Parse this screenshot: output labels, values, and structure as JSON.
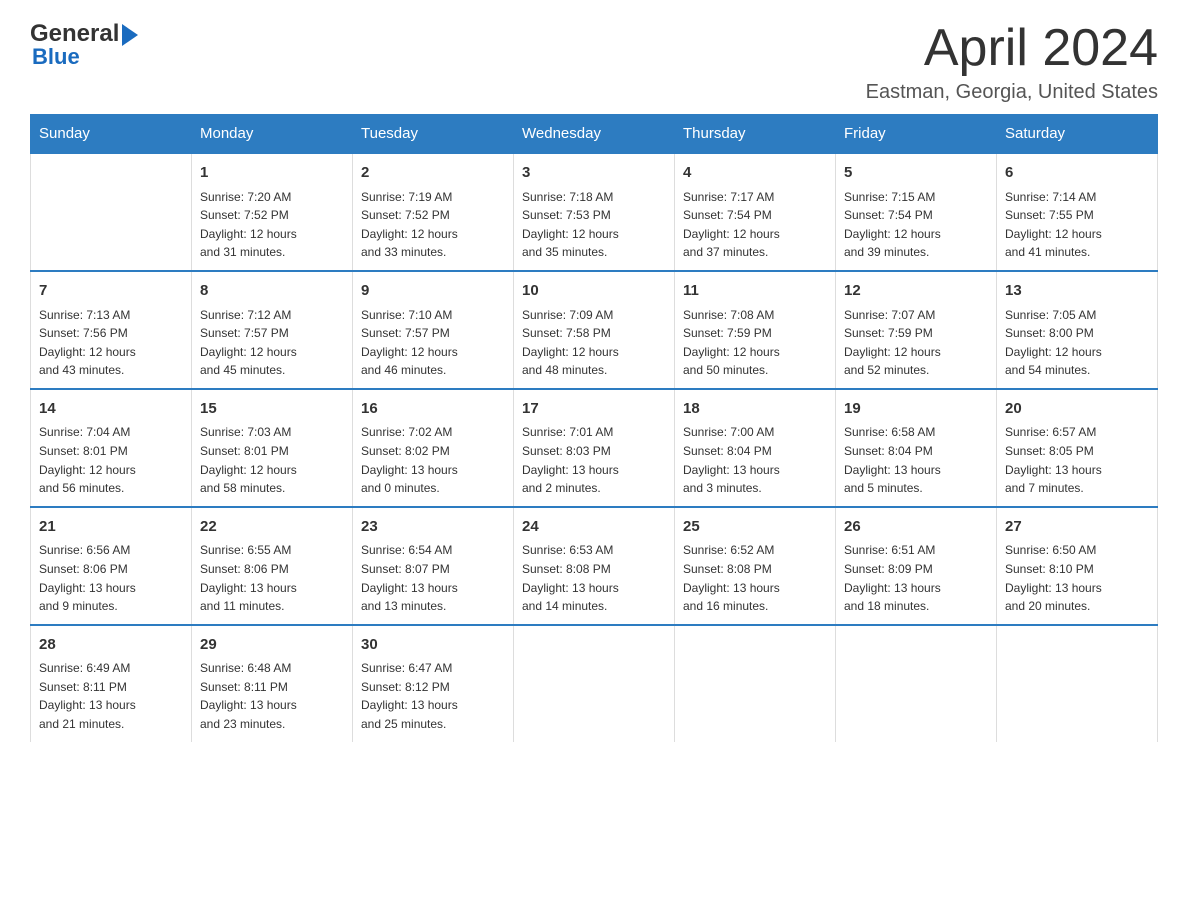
{
  "logo": {
    "text_general": "General",
    "triangle": "▶",
    "text_blue": "Blue"
  },
  "title": "April 2024",
  "location": "Eastman, Georgia, United States",
  "days_of_week": [
    "Sunday",
    "Monday",
    "Tuesday",
    "Wednesday",
    "Thursday",
    "Friday",
    "Saturday"
  ],
  "weeks": [
    {
      "days": [
        {
          "num": "",
          "info": ""
        },
        {
          "num": "1",
          "info": "Sunrise: 7:20 AM\nSunset: 7:52 PM\nDaylight: 12 hours\nand 31 minutes."
        },
        {
          "num": "2",
          "info": "Sunrise: 7:19 AM\nSunset: 7:52 PM\nDaylight: 12 hours\nand 33 minutes."
        },
        {
          "num": "3",
          "info": "Sunrise: 7:18 AM\nSunset: 7:53 PM\nDaylight: 12 hours\nand 35 minutes."
        },
        {
          "num": "4",
          "info": "Sunrise: 7:17 AM\nSunset: 7:54 PM\nDaylight: 12 hours\nand 37 minutes."
        },
        {
          "num": "5",
          "info": "Sunrise: 7:15 AM\nSunset: 7:54 PM\nDaylight: 12 hours\nand 39 minutes."
        },
        {
          "num": "6",
          "info": "Sunrise: 7:14 AM\nSunset: 7:55 PM\nDaylight: 12 hours\nand 41 minutes."
        }
      ]
    },
    {
      "days": [
        {
          "num": "7",
          "info": "Sunrise: 7:13 AM\nSunset: 7:56 PM\nDaylight: 12 hours\nand 43 minutes."
        },
        {
          "num": "8",
          "info": "Sunrise: 7:12 AM\nSunset: 7:57 PM\nDaylight: 12 hours\nand 45 minutes."
        },
        {
          "num": "9",
          "info": "Sunrise: 7:10 AM\nSunset: 7:57 PM\nDaylight: 12 hours\nand 46 minutes."
        },
        {
          "num": "10",
          "info": "Sunrise: 7:09 AM\nSunset: 7:58 PM\nDaylight: 12 hours\nand 48 minutes."
        },
        {
          "num": "11",
          "info": "Sunrise: 7:08 AM\nSunset: 7:59 PM\nDaylight: 12 hours\nand 50 minutes."
        },
        {
          "num": "12",
          "info": "Sunrise: 7:07 AM\nSunset: 7:59 PM\nDaylight: 12 hours\nand 52 minutes."
        },
        {
          "num": "13",
          "info": "Sunrise: 7:05 AM\nSunset: 8:00 PM\nDaylight: 12 hours\nand 54 minutes."
        }
      ]
    },
    {
      "days": [
        {
          "num": "14",
          "info": "Sunrise: 7:04 AM\nSunset: 8:01 PM\nDaylight: 12 hours\nand 56 minutes."
        },
        {
          "num": "15",
          "info": "Sunrise: 7:03 AM\nSunset: 8:01 PM\nDaylight: 12 hours\nand 58 minutes."
        },
        {
          "num": "16",
          "info": "Sunrise: 7:02 AM\nSunset: 8:02 PM\nDaylight: 13 hours\nand 0 minutes."
        },
        {
          "num": "17",
          "info": "Sunrise: 7:01 AM\nSunset: 8:03 PM\nDaylight: 13 hours\nand 2 minutes."
        },
        {
          "num": "18",
          "info": "Sunrise: 7:00 AM\nSunset: 8:04 PM\nDaylight: 13 hours\nand 3 minutes."
        },
        {
          "num": "19",
          "info": "Sunrise: 6:58 AM\nSunset: 8:04 PM\nDaylight: 13 hours\nand 5 minutes."
        },
        {
          "num": "20",
          "info": "Sunrise: 6:57 AM\nSunset: 8:05 PM\nDaylight: 13 hours\nand 7 minutes."
        }
      ]
    },
    {
      "days": [
        {
          "num": "21",
          "info": "Sunrise: 6:56 AM\nSunset: 8:06 PM\nDaylight: 13 hours\nand 9 minutes."
        },
        {
          "num": "22",
          "info": "Sunrise: 6:55 AM\nSunset: 8:06 PM\nDaylight: 13 hours\nand 11 minutes."
        },
        {
          "num": "23",
          "info": "Sunrise: 6:54 AM\nSunset: 8:07 PM\nDaylight: 13 hours\nand 13 minutes."
        },
        {
          "num": "24",
          "info": "Sunrise: 6:53 AM\nSunset: 8:08 PM\nDaylight: 13 hours\nand 14 minutes."
        },
        {
          "num": "25",
          "info": "Sunrise: 6:52 AM\nSunset: 8:08 PM\nDaylight: 13 hours\nand 16 minutes."
        },
        {
          "num": "26",
          "info": "Sunrise: 6:51 AM\nSunset: 8:09 PM\nDaylight: 13 hours\nand 18 minutes."
        },
        {
          "num": "27",
          "info": "Sunrise: 6:50 AM\nSunset: 8:10 PM\nDaylight: 13 hours\nand 20 minutes."
        }
      ]
    },
    {
      "days": [
        {
          "num": "28",
          "info": "Sunrise: 6:49 AM\nSunset: 8:11 PM\nDaylight: 13 hours\nand 21 minutes."
        },
        {
          "num": "29",
          "info": "Sunrise: 6:48 AM\nSunset: 8:11 PM\nDaylight: 13 hours\nand 23 minutes."
        },
        {
          "num": "30",
          "info": "Sunrise: 6:47 AM\nSunset: 8:12 PM\nDaylight: 13 hours\nand 25 minutes."
        },
        {
          "num": "",
          "info": ""
        },
        {
          "num": "",
          "info": ""
        },
        {
          "num": "",
          "info": ""
        },
        {
          "num": "",
          "info": ""
        }
      ]
    }
  ]
}
